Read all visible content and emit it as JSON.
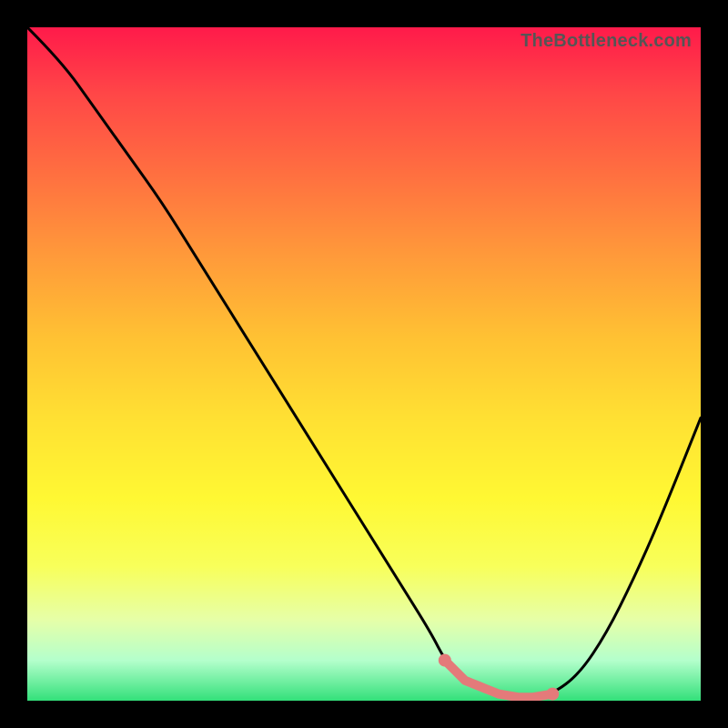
{
  "watermark": "TheBottleneck.com",
  "chart_data": {
    "type": "line",
    "title": "",
    "xlabel": "",
    "ylabel": "",
    "xlim": [
      0,
      100
    ],
    "ylim": [
      0,
      100
    ],
    "x": [
      0,
      5,
      10,
      15,
      20,
      25,
      30,
      35,
      40,
      45,
      50,
      55,
      60,
      62,
      65,
      70,
      73,
      75,
      78,
      82,
      86,
      90,
      94,
      100
    ],
    "values": [
      100,
      95,
      88,
      81,
      74,
      66,
      58,
      50,
      42,
      34,
      26,
      18,
      10,
      6,
      3,
      1,
      0.5,
      0.5,
      1,
      4,
      10,
      18,
      27,
      42
    ],
    "optimal_range": {
      "x_start": 62,
      "x_end": 78
    },
    "markers": [
      {
        "x": 62,
        "y": 6
      },
      {
        "x": 78,
        "y": 1
      }
    ],
    "background": {
      "type": "vertical-gradient",
      "stops": [
        {
          "pos": 0,
          "meaning": "worst",
          "color": "#ff1a4a"
        },
        {
          "pos": 100,
          "meaning": "best",
          "color": "#33e07a"
        }
      ]
    }
  }
}
